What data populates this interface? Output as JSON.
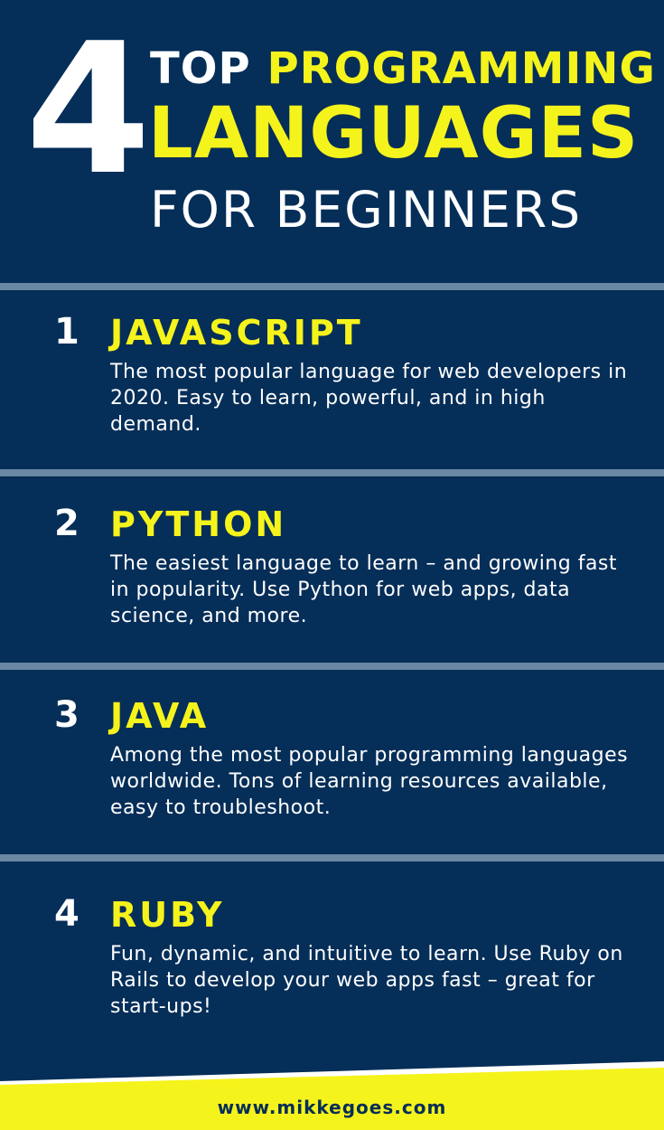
{
  "header": {
    "big_number": "4",
    "line1_white": "TOP",
    "line1_yellow": "PROGRAMMING",
    "line2": "LANGUAGES",
    "line3": "FOR BEGINNERS"
  },
  "items": [
    {
      "number": "1",
      "name": "JAVASCRIPT",
      "description": "The most popular language for web developers in 2020. Easy to learn, powerful, and in high demand."
    },
    {
      "number": "2",
      "name": "PYTHON",
      "description": "The easiest language to learn – and growing fast in popularity. Use Python for web apps, data science, and more."
    },
    {
      "number": "3",
      "name": "JAVA",
      "description": "Among the most popular programming languages worldwide. Tons of learning resources available, easy to troubleshoot."
    },
    {
      "number": "4",
      "name": "RUBY",
      "description": "Fun, dynamic, and intuitive to learn. Use Ruby on Rails to develop your web apps fast – great for start-ups!"
    }
  ],
  "footer": {
    "url": "www.mikkegoes.com"
  },
  "colors": {
    "background": "#052e58",
    "accent_yellow": "#f5f31c",
    "divider": "#6a87a3",
    "text_white": "#ffffff"
  }
}
